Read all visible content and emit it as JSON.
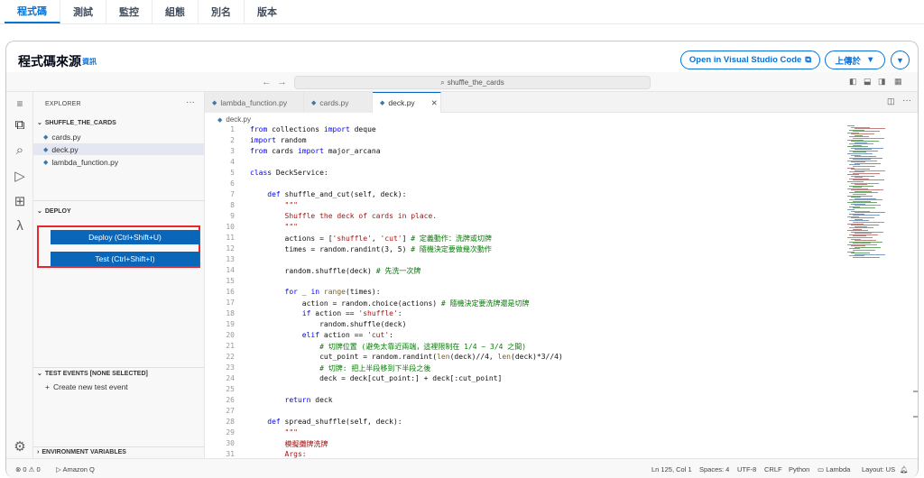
{
  "top_tabs": [
    "程式碼",
    "測試",
    "監控",
    "組態",
    "別名",
    "版本"
  ],
  "panel": {
    "title": "程式碼來源",
    "info": "資訊",
    "open_vscode": "Open in Visual Studio Code",
    "upload": "上傳於"
  },
  "ide": {
    "search_text": "shuffle_the_cards",
    "explorer_label": "EXPLORER",
    "folder": "SHUFFLE_THE_CARDS",
    "files": [
      "cards.py",
      "deck.py",
      "lambda_function.py"
    ],
    "deploy_section": "DEPLOY",
    "deploy_button": "Deploy (Ctrl+Shift+U)",
    "test_button": "Test (Ctrl+Shift+I)",
    "test_events": "TEST EVENTS [NONE SELECTED]",
    "create_test": "Create new test event",
    "env_vars": "ENVIRONMENT VARIABLES",
    "tabs": [
      "lambda_function.py",
      "cards.py",
      "deck.py"
    ],
    "breadcrumb": "deck.py"
  },
  "code_lines": [
    {
      "n": "1",
      "t": "from collections import deque"
    },
    {
      "n": "2",
      "t": "import random"
    },
    {
      "n": "3",
      "t": "from cards import major_arcana"
    },
    {
      "n": "4",
      "t": ""
    },
    {
      "n": "5",
      "t": "class DeckService:"
    },
    {
      "n": "6",
      "t": ""
    },
    {
      "n": "7",
      "t": "    def shuffle_and_cut(self, deck):"
    },
    {
      "n": "8",
      "t": "        \"\"\""
    },
    {
      "n": "9",
      "t": "        Shuffle the deck of cards in place."
    },
    {
      "n": "10",
      "t": "        \"\"\""
    },
    {
      "n": "11",
      "t": "        actions = ['shuffle', 'cut'] # 定義動作：洗牌或切牌"
    },
    {
      "n": "12",
      "t": "        times = random.randint(3, 5) # 隨機決定要做幾次動作"
    },
    {
      "n": "13",
      "t": ""
    },
    {
      "n": "14",
      "t": "        random.shuffle(deck) # 先洗一次牌"
    },
    {
      "n": "15",
      "t": ""
    },
    {
      "n": "16",
      "t": "        for _ in range(times):"
    },
    {
      "n": "17",
      "t": "            action = random.choice(actions) # 隨機決定要洗牌還是切牌"
    },
    {
      "n": "18",
      "t": "            if action == 'shuffle':"
    },
    {
      "n": "19",
      "t": "                random.shuffle(deck)"
    },
    {
      "n": "20",
      "t": "            elif action == 'cut':"
    },
    {
      "n": "21",
      "t": "                # 切牌位置 (避免太靠近兩端，這裡限制在 1/4 ~ 3/4 之間)"
    },
    {
      "n": "22",
      "t": "                cut_point = random.randint(len(deck)//4, len(deck)*3//4)"
    },
    {
      "n": "23",
      "t": "                # 切牌: 把上半段移到下半段之後"
    },
    {
      "n": "24",
      "t": "                deck = deck[cut_point:] + deck[:cut_point]"
    },
    {
      "n": "25",
      "t": ""
    },
    {
      "n": "26",
      "t": "        return deck"
    },
    {
      "n": "27",
      "t": ""
    },
    {
      "n": "28",
      "t": "    def spread_shuffle(self, deck):"
    },
    {
      "n": "29",
      "t": "        \"\"\""
    },
    {
      "n": "30",
      "t": "        模擬攤牌洗牌"
    },
    {
      "n": "31",
      "t": "        Args:"
    }
  ],
  "status": {
    "errors": "0",
    "warnings": "0",
    "amazon_q": "Amazon Q",
    "position": "Ln 125, Col 1",
    "spaces": "Spaces: 4",
    "encoding": "UTF-8",
    "eol": "CRLF",
    "language": "Python",
    "runtime": "Lambda",
    "layout": "Layout: US"
  },
  "colors": {
    "accent": "#0972d3",
    "deploy_button": "#0a66b8",
    "highlight_border": "#e8262e",
    "keyword": "#0000ff",
    "string": "#a31515",
    "comment": "#008000"
  }
}
